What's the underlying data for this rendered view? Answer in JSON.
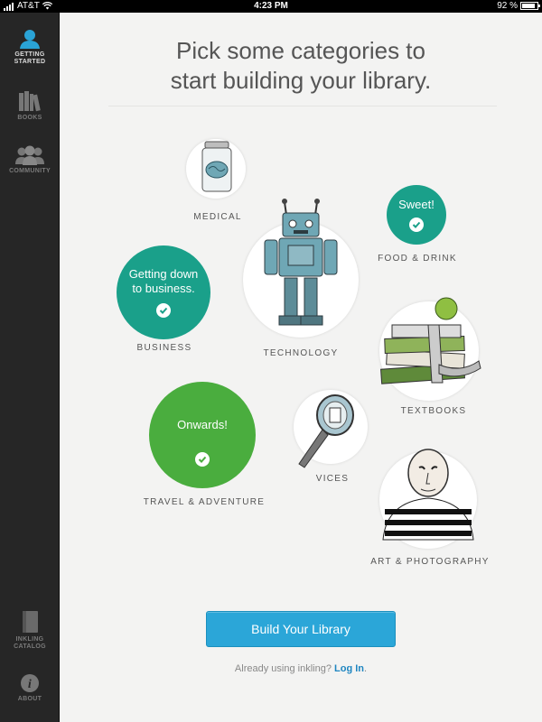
{
  "status_bar": {
    "carrier": "AT&T",
    "time": "4:23 PM",
    "battery": "92 %"
  },
  "sidebar": {
    "items": [
      {
        "label": "GETTING STARTED",
        "icon": "person-icon"
      },
      {
        "label": "BOOKS",
        "icon": "books-icon"
      },
      {
        "label": "COMMUNITY",
        "icon": "people-icon"
      },
      {
        "label": "INKLING CATALOG",
        "icon": "catalog-book-icon"
      },
      {
        "label": "ABOUT",
        "icon": "info-icon"
      }
    ]
  },
  "main": {
    "heading_line1": "Pick some categories to",
    "heading_line2": "start building your library.",
    "categories": [
      {
        "label": "MEDICAL",
        "selected": false,
        "icon": "brain-jar-icon"
      },
      {
        "label": "FOOD & DRINK",
        "selected": true,
        "message": "Sweet!",
        "color": "#1aa08a"
      },
      {
        "label": "BUSINESS",
        "selected": true,
        "message": "Getting down to business.",
        "color": "#1aa08a"
      },
      {
        "label": "TECHNOLOGY",
        "selected": false,
        "icon": "robot-icon"
      },
      {
        "label": "TEXTBOOKS",
        "selected": false,
        "icon": "book-stack-apple-icon"
      },
      {
        "label": "TRAVEL & ADVENTURE",
        "selected": true,
        "message": "Onwards!",
        "color": "#4aad3e"
      },
      {
        "label": "VICES",
        "selected": false,
        "icon": "hand-mirror-icon"
      },
      {
        "label": "ART & PHOTOGRAPHY",
        "selected": false,
        "icon": "portrait-icon"
      }
    ],
    "cta_label": "Build Your Library",
    "login_prompt": "Already using inkling?",
    "login_link": "Log In",
    "login_suffix": "."
  },
  "colors": {
    "accent": "#2ba6d8",
    "teal": "#1aa08a",
    "green": "#4aad3e",
    "sidebar": "#262626"
  }
}
